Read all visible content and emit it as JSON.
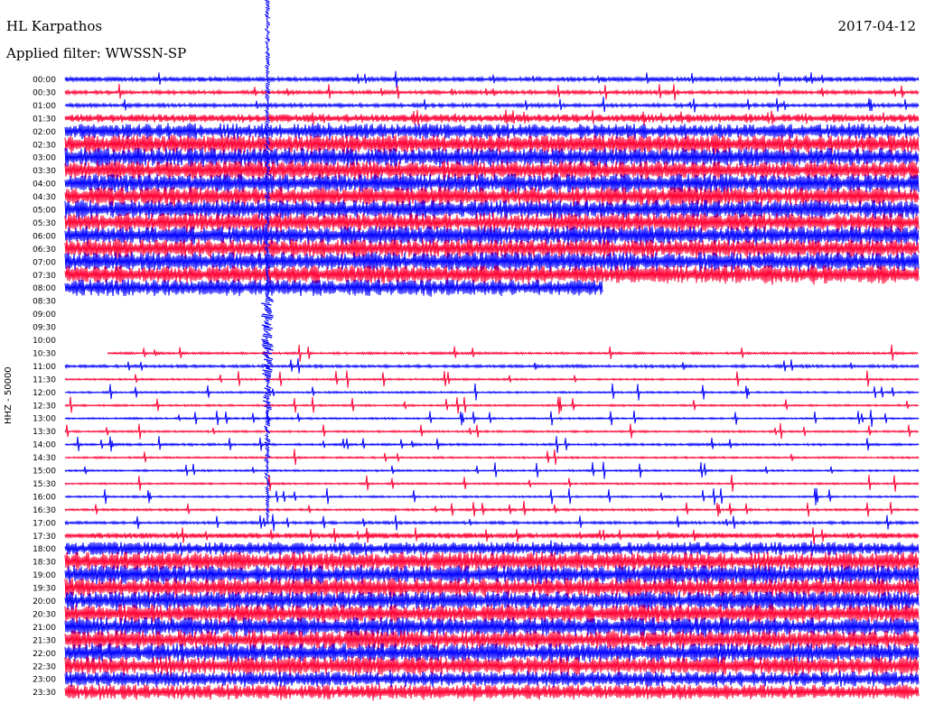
{
  "header": {
    "station": "HL Karpathos",
    "date": "2017-04-12",
    "filter": "Applied filter: WWSSN-SP"
  },
  "chart_data": {
    "type": "line",
    "ylabel": "HHZ - 50000",
    "colors": [
      "#0000ff",
      "#ff0033"
    ],
    "rows": [
      {
        "label": "00:00",
        "amp": 0.25,
        "start": 0,
        "end": 1
      },
      {
        "label": "00:30",
        "amp": 0.2,
        "start": 0,
        "end": 1
      },
      {
        "label": "01:00",
        "amp": 0.2,
        "start": 0,
        "end": 1
      },
      {
        "label": "01:30",
        "amp": 0.45,
        "start": 0,
        "end": 1
      },
      {
        "label": "02:00",
        "amp": 0.8,
        "start": 0,
        "end": 1
      },
      {
        "label": "02:30",
        "amp": 1.0,
        "start": 0,
        "end": 1
      },
      {
        "label": "03:00",
        "amp": 1.0,
        "start": 0,
        "end": 1
      },
      {
        "label": "03:30",
        "amp": 1.0,
        "start": 0,
        "end": 1
      },
      {
        "label": "04:00",
        "amp": 1.0,
        "start": 0,
        "end": 1
      },
      {
        "label": "04:30",
        "amp": 1.0,
        "start": 0,
        "end": 1
      },
      {
        "label": "05:00",
        "amp": 1.0,
        "start": 0,
        "end": 1
      },
      {
        "label": "05:30",
        "amp": 1.0,
        "start": 0,
        "end": 1
      },
      {
        "label": "06:00",
        "amp": 1.0,
        "start": 0,
        "end": 1
      },
      {
        "label": "06:30",
        "amp": 1.0,
        "start": 0,
        "end": 1
      },
      {
        "label": "07:00",
        "amp": 1.0,
        "start": 0,
        "end": 1
      },
      {
        "label": "07:30",
        "amp": 1.0,
        "start": 0,
        "end": 1
      },
      {
        "label": "08:00",
        "amp": 0.9,
        "start": 0,
        "end": 0.63
      },
      {
        "label": "08:30",
        "amp": 0,
        "start": 0,
        "end": 0
      },
      {
        "label": "09:00",
        "amp": 0,
        "start": 0,
        "end": 0
      },
      {
        "label": "09:30",
        "amp": 0,
        "start": 0,
        "end": 0
      },
      {
        "label": "10:00",
        "amp": 0,
        "start": 0,
        "end": 0
      },
      {
        "label": "10:30",
        "amp": 0.12,
        "start": 0.05,
        "end": 1
      },
      {
        "label": "11:00",
        "amp": 0.15,
        "start": 0,
        "end": 1
      },
      {
        "label": "11:30",
        "amp": 0.1,
        "start": 0,
        "end": 1
      },
      {
        "label": "12:00",
        "amp": 0.1,
        "start": 0,
        "end": 1
      },
      {
        "label": "12:30",
        "amp": 0.1,
        "start": 0,
        "end": 1
      },
      {
        "label": "13:00",
        "amp": 0.1,
        "start": 0,
        "end": 1
      },
      {
        "label": "13:30",
        "amp": 0.1,
        "start": 0,
        "end": 1
      },
      {
        "label": "14:00",
        "amp": 0.12,
        "start": 0,
        "end": 1
      },
      {
        "label": "14:30",
        "amp": 0.1,
        "start": 0,
        "end": 1
      },
      {
        "label": "15:00",
        "amp": 0.1,
        "start": 0,
        "end": 1
      },
      {
        "label": "15:30",
        "amp": 0.1,
        "start": 0,
        "end": 1
      },
      {
        "label": "16:00",
        "amp": 0.1,
        "start": 0,
        "end": 1
      },
      {
        "label": "16:30",
        "amp": 0.12,
        "start": 0,
        "end": 1
      },
      {
        "label": "17:00",
        "amp": 0.15,
        "start": 0,
        "end": 1
      },
      {
        "label": "17:30",
        "amp": 0.3,
        "start": 0,
        "end": 1
      },
      {
        "label": "18:00",
        "amp": 0.7,
        "start": 0,
        "end": 1
      },
      {
        "label": "18:30",
        "amp": 1.0,
        "start": 0,
        "end": 1
      },
      {
        "label": "19:00",
        "amp": 1.0,
        "start": 0,
        "end": 1
      },
      {
        "label": "19:30",
        "amp": 1.0,
        "start": 0,
        "end": 1
      },
      {
        "label": "20:00",
        "amp": 1.0,
        "start": 0,
        "end": 1
      },
      {
        "label": "20:30",
        "amp": 1.0,
        "start": 0,
        "end": 1
      },
      {
        "label": "21:00",
        "amp": 1.0,
        "start": 0,
        "end": 1
      },
      {
        "label": "21:30",
        "amp": 1.0,
        "start": 0,
        "end": 1
      },
      {
        "label": "22:00",
        "amp": 1.0,
        "start": 0,
        "end": 1
      },
      {
        "label": "22:30",
        "amp": 1.0,
        "start": 0,
        "end": 1
      },
      {
        "label": "23:00",
        "amp": 0.8,
        "start": 0,
        "end": 1
      },
      {
        "label": "23:30",
        "amp": 0.8,
        "start": 0,
        "end": 1
      }
    ]
  }
}
